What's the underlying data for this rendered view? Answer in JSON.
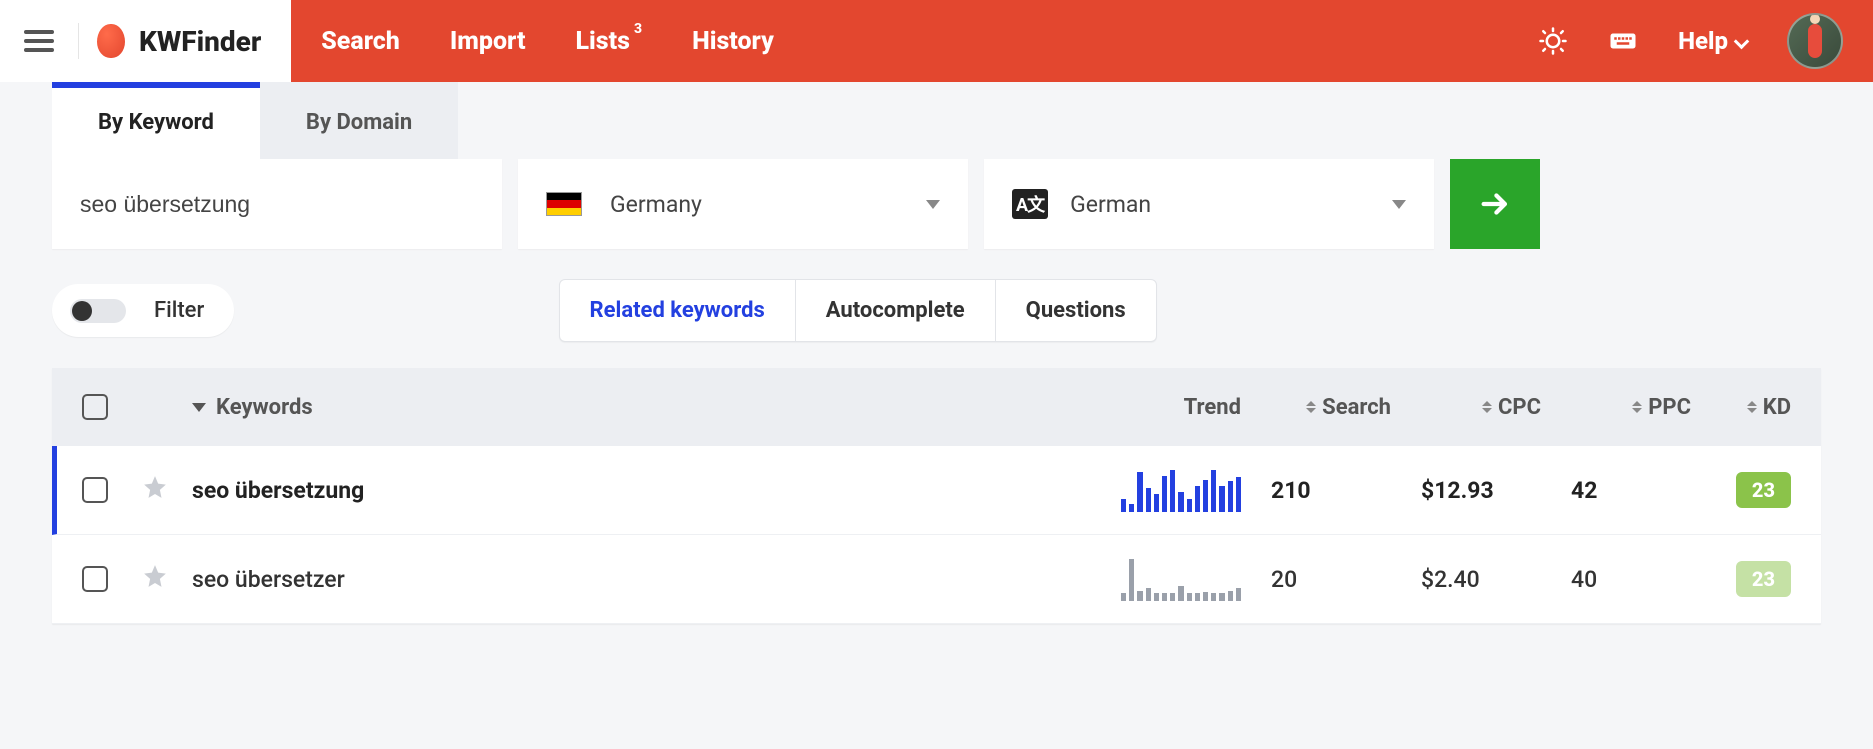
{
  "app_name": "KWFinder",
  "nav": {
    "search": "Search",
    "import": "Import",
    "lists": "Lists",
    "lists_count": "3",
    "history": "History",
    "help": "Help"
  },
  "tabs": {
    "by_keyword": "By Keyword",
    "by_domain": "By Domain"
  },
  "search": {
    "keyword": "seo übersetzung",
    "location": "Germany",
    "language": "German"
  },
  "filter_label": "Filter",
  "result_tabs": {
    "related": "Related keywords",
    "autocomplete": "Autocomplete",
    "questions": "Questions"
  },
  "columns": {
    "keywords": "Keywords",
    "trend": "Trend",
    "search": "Search",
    "cpc": "CPC",
    "ppc": "PPC",
    "kd": "KD"
  },
  "rows": [
    {
      "keyword": "seo übersetzung",
      "search": "210",
      "cpc": "$12.93",
      "ppc": "42",
      "kd": "23",
      "active": true,
      "trend": [
        30,
        18,
        90,
        55,
        40,
        82,
        95,
        45,
        30,
        60,
        72,
        95,
        58,
        70,
        80
      ]
    },
    {
      "keyword": "seo übersetzer",
      "search": "20",
      "cpc": "$2.40",
      "ppc": "40",
      "kd": "23",
      "active": false,
      "trend": [
        10,
        95,
        22,
        30,
        12,
        18,
        10,
        35,
        14,
        16,
        20,
        12,
        10,
        22,
        30
      ]
    }
  ],
  "chart_data": [
    {
      "type": "bar",
      "title": "Trend: seo übersetzung",
      "xlabel": "",
      "ylabel": "",
      "ylim": [
        0,
        100
      ],
      "categories": [
        "1",
        "2",
        "3",
        "4",
        "5",
        "6",
        "7",
        "8",
        "9",
        "10",
        "11",
        "12",
        "13",
        "14",
        "15"
      ],
      "values": [
        30,
        18,
        90,
        55,
        40,
        82,
        95,
        45,
        30,
        60,
        72,
        95,
        58,
        70,
        80
      ]
    },
    {
      "type": "bar",
      "title": "Trend: seo übersetzer",
      "xlabel": "",
      "ylabel": "",
      "ylim": [
        0,
        100
      ],
      "categories": [
        "1",
        "2",
        "3",
        "4",
        "5",
        "6",
        "7",
        "8",
        "9",
        "10",
        "11",
        "12",
        "13",
        "14",
        "15"
      ],
      "values": [
        10,
        95,
        22,
        30,
        12,
        18,
        10,
        35,
        14,
        16,
        20,
        12,
        10,
        22,
        30
      ]
    }
  ]
}
